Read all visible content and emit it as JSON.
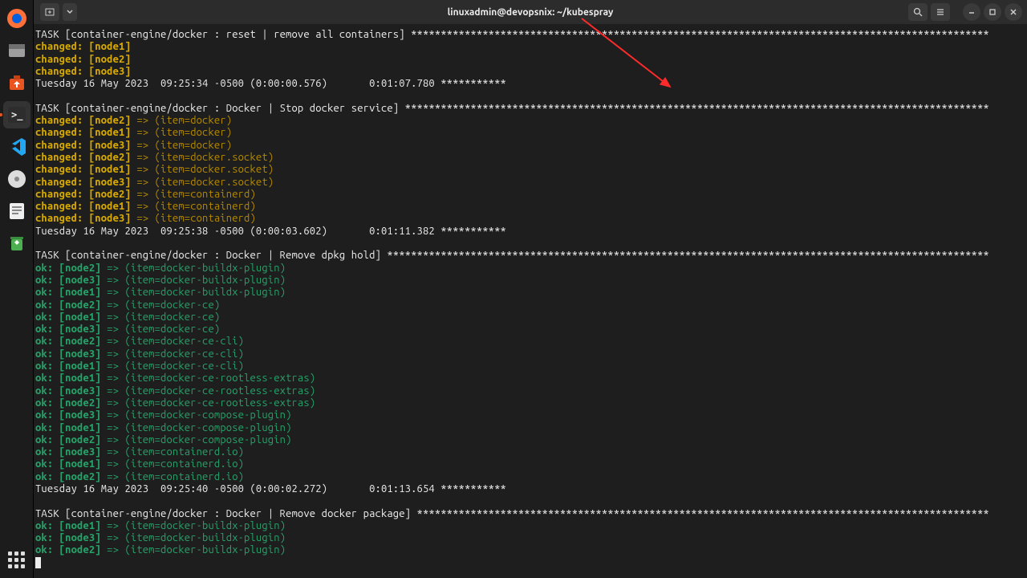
{
  "window": {
    "title": "linuxadmin@devopsnix: ~/kubespray"
  },
  "dock": {
    "items": [
      {
        "name": "firefox-icon"
      },
      {
        "name": "files-icon"
      },
      {
        "name": "software-icon"
      },
      {
        "name": "terminal-icon",
        "active": true
      },
      {
        "name": "vscode-icon"
      },
      {
        "name": "disc-icon"
      },
      {
        "name": "text-editor-icon"
      },
      {
        "name": "trash-icon"
      }
    ],
    "apps_button": "apps"
  },
  "tasks": [
    {
      "header": "TASK [container-engine/docker : reset | remove all containers] ",
      "lines": [
        {
          "style": "changed",
          "text": "changed: [node1]"
        },
        {
          "style": "changed",
          "text": "changed: [node2]"
        },
        {
          "style": "changed",
          "text": "changed: [node3]"
        }
      ],
      "footer": "Tuesday 16 May 2023  09:25:34 -0500 (0:00:00.576)       0:01:07.780 ***********"
    },
    {
      "header": "TASK [container-engine/docker : Docker | Stop docker service] ",
      "lines": [
        {
          "style": "changed",
          "text": "changed: [node2] => (item=docker)"
        },
        {
          "style": "changed",
          "text": "changed: [node1] => (item=docker)"
        },
        {
          "style": "changed",
          "text": "changed: [node3] => (item=docker)"
        },
        {
          "style": "changed",
          "text": "changed: [node2] => (item=docker.socket)"
        },
        {
          "style": "changed",
          "text": "changed: [node1] => (item=docker.socket)"
        },
        {
          "style": "changed",
          "text": "changed: [node3] => (item=docker.socket)"
        },
        {
          "style": "changed",
          "text": "changed: [node2] => (item=containerd)"
        },
        {
          "style": "changed",
          "text": "changed: [node1] => (item=containerd)"
        },
        {
          "style": "changed",
          "text": "changed: [node3] => (item=containerd)"
        }
      ],
      "footer": "Tuesday 16 May 2023  09:25:38 -0500 (0:00:03.602)       0:01:11.382 ***********"
    },
    {
      "header": "TASK [container-engine/docker : Docker | Remove dpkg hold] ",
      "lines": [
        {
          "style": "ok",
          "text": "ok: [node2] => (item=docker-buildx-plugin)"
        },
        {
          "style": "ok",
          "text": "ok: [node3] => (item=docker-buildx-plugin)"
        },
        {
          "style": "ok",
          "text": "ok: [node1] => (item=docker-buildx-plugin)"
        },
        {
          "style": "ok",
          "text": "ok: [node2] => (item=docker-ce)"
        },
        {
          "style": "ok",
          "text": "ok: [node1] => (item=docker-ce)"
        },
        {
          "style": "ok",
          "text": "ok: [node3] => (item=docker-ce)"
        },
        {
          "style": "ok",
          "text": "ok: [node2] => (item=docker-ce-cli)"
        },
        {
          "style": "ok",
          "text": "ok: [node3] => (item=docker-ce-cli)"
        },
        {
          "style": "ok",
          "text": "ok: [node1] => (item=docker-ce-cli)"
        },
        {
          "style": "ok",
          "text": "ok: [node1] => (item=docker-ce-rootless-extras)"
        },
        {
          "style": "ok",
          "text": "ok: [node3] => (item=docker-ce-rootless-extras)"
        },
        {
          "style": "ok",
          "text": "ok: [node2] => (item=docker-ce-rootless-extras)"
        },
        {
          "style": "ok",
          "text": "ok: [node3] => (item=docker-compose-plugin)"
        },
        {
          "style": "ok",
          "text": "ok: [node1] => (item=docker-compose-plugin)"
        },
        {
          "style": "ok",
          "text": "ok: [node2] => (item=docker-compose-plugin)"
        },
        {
          "style": "ok",
          "text": "ok: [node3] => (item=containerd.io)"
        },
        {
          "style": "ok",
          "text": "ok: [node1] => (item=containerd.io)"
        },
        {
          "style": "ok",
          "text": "ok: [node2] => (item=containerd.io)"
        }
      ],
      "footer": "Tuesday 16 May 2023  09:25:40 -0500 (0:00:02.272)       0:01:13.654 ***********"
    },
    {
      "header": "TASK [container-engine/docker : Docker | Remove docker package] ",
      "lines": [
        {
          "style": "ok",
          "text": "ok: [node1] => (item=docker-buildx-plugin)"
        },
        {
          "style": "ok",
          "text": "ok: [node3] => (item=docker-buildx-plugin)"
        },
        {
          "style": "ok",
          "text": "ok: [node2] => (item=docker-buildx-plugin)"
        }
      ],
      "footer": ""
    }
  ],
  "header_fill_width": 160
}
